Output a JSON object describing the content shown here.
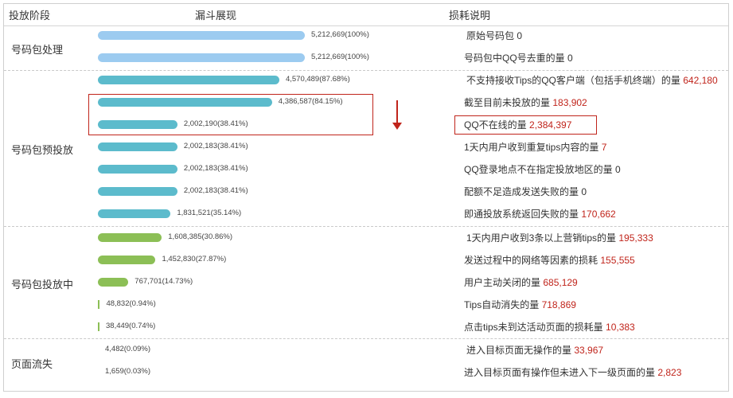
{
  "headers": {
    "stage": "投放阶段",
    "funnel": "漏斗展现",
    "loss": "损耗说明"
  },
  "stages": [
    {
      "label": "号码包处理"
    },
    {
      "label": "号码包预投放"
    },
    {
      "label": "号码包投放中"
    },
    {
      "label": "页面流失"
    }
  ],
  "chart_data": {
    "type": "bar",
    "orientation": "horizontal",
    "ylim": [
      0,
      100
    ],
    "rows": [
      {
        "stage": "号码包处理",
        "value": 5212669,
        "percent": 100,
        "label": "5,212,669(100%)",
        "desc": "原始号码包",
        "loss": "0",
        "color": "#9ccbf0"
      },
      {
        "stage": "号码包处理",
        "value": 5212669,
        "percent": 100,
        "label": "5,212,669(100%)",
        "desc": "号码包中QQ号去重的量",
        "loss": "0",
        "color": "#9ccbf0"
      },
      {
        "stage": "号码包预投放",
        "value": 4570489,
        "percent": 87.68,
        "label": "4,570,489(87.68%)",
        "desc": "不支持接收Tips的QQ客户端（包括手机终端）的量",
        "loss": "642,180",
        "color": "#5cbbcc"
      },
      {
        "stage": "号码包预投放",
        "value": 4386587,
        "percent": 84.15,
        "label": "4,386,587(84.15%)",
        "desc": "截至目前未投放的量",
        "loss": "183,902",
        "color": "#5cbbcc"
      },
      {
        "stage": "号码包预投放",
        "value": 2002190,
        "percent": 38.41,
        "label": "2,002,190(38.41%)",
        "desc": "QQ不在线的量",
        "loss": "2,384,397",
        "color": "#5cbbcc"
      },
      {
        "stage": "号码包预投放",
        "value": 2002183,
        "percent": 38.41,
        "label": "2,002,183(38.41%)",
        "desc": "1天内用户收到重复tips内容的量",
        "loss": "7",
        "color": "#5cbbcc"
      },
      {
        "stage": "号码包预投放",
        "value": 2002183,
        "percent": 38.41,
        "label": "2,002,183(38.41%)",
        "desc": "QQ登录地点不在指定投放地区的量",
        "loss": "0",
        "color": "#5cbbcc"
      },
      {
        "stage": "号码包预投放",
        "value": 2002183,
        "percent": 38.41,
        "label": "2,002,183(38.41%)",
        "desc": "配额不足造成发送失败的量",
        "loss": "0",
        "color": "#5cbbcc"
      },
      {
        "stage": "号码包预投放",
        "value": 1831521,
        "percent": 35.14,
        "label": "1,831,521(35.14%)",
        "desc": "即通投放系统返回失败的量",
        "loss": "170,662",
        "color": "#5cbbcc"
      },
      {
        "stage": "号码包投放中",
        "value": 1608385,
        "percent": 30.86,
        "label": "1,608,385(30.86%)",
        "desc": "1天内用户收到3条以上营销tips的量",
        "loss": "195,333",
        "color": "#8cbf56"
      },
      {
        "stage": "号码包投放中",
        "value": 1452830,
        "percent": 27.87,
        "label": "1,452,830(27.87%)",
        "desc": "发送过程中的网络等因素的损耗",
        "loss": "155,555",
        "color": "#8cbf56"
      },
      {
        "stage": "号码包投放中",
        "value": 767701,
        "percent": 14.73,
        "label": "767,701(14.73%)",
        "desc": "用户主动关闭的量",
        "loss": "685,129",
        "color": "#8cbf56"
      },
      {
        "stage": "号码包投放中",
        "value": 48832,
        "percent": 0.94,
        "label": "48,832(0.94%)",
        "desc": "Tips自动消失的量",
        "loss": "718,869",
        "color": "#8cbf56"
      },
      {
        "stage": "号码包投放中",
        "value": 38449,
        "percent": 0.74,
        "label": "38,449(0.74%)",
        "desc": "点击tips未到达活动页面的损耗量",
        "loss": "10,383",
        "color": "#8cbf56"
      },
      {
        "stage": "页面流失",
        "value": 4482,
        "percent": 0.09,
        "label": "4,482(0.09%)",
        "desc": "进入目标页面无操作的量",
        "loss": "33,967",
        "color": "#9ccbf0"
      },
      {
        "stage": "页面流失",
        "value": 1659,
        "percent": 0.03,
        "label": "1,659(0.03%)",
        "desc": "进入目标页面有操作但未进入下一级页面的量",
        "loss": "2,823",
        "color": "#9ccbf0"
      }
    ]
  }
}
